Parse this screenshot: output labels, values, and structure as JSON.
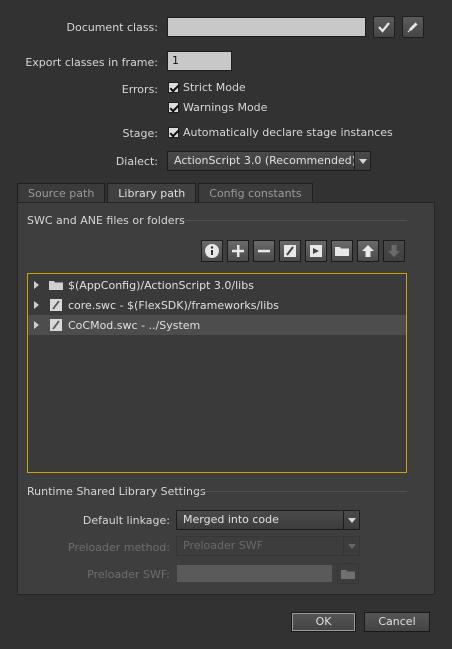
{
  "fields": {
    "document_class_label": "Document class:",
    "document_class_value": "",
    "export_frame_label": "Export classes in frame:",
    "export_frame_value": "1",
    "errors_label": "Errors:",
    "strict_mode_label": "Strict Mode",
    "strict_mode_checked": true,
    "warnings_mode_label": "Warnings Mode",
    "warnings_mode_checked": true,
    "stage_label": "Stage:",
    "auto_declare_label": "Automatically declare stage instances",
    "auto_declare_checked": true,
    "dialect_label": "Dialect:",
    "dialect_value": "ActionScript 3.0 (Recommended)"
  },
  "tabs": [
    {
      "label": "Source path",
      "active": false
    },
    {
      "label": "Library path",
      "active": true
    },
    {
      "label": "Config constants",
      "active": false
    }
  ],
  "library": {
    "section_title": "SWC and ANE files or folders",
    "toolbar_icons": [
      "info-icon",
      "add-icon",
      "remove-icon",
      "flex-sdk-icon",
      "swc-icon",
      "folder-icon",
      "move-up-icon",
      "move-down-icon"
    ],
    "items": [
      {
        "label": "$(AppConfig)/ActionScript 3.0/libs",
        "icon": "folder-icon",
        "selected": false
      },
      {
        "label": "core.swc - $(FlexSDK)/frameworks/libs",
        "icon": "swc-file-icon",
        "selected": false
      },
      {
        "label": "CoCMod.swc - ../System",
        "icon": "swc-file-icon",
        "selected": true
      }
    ]
  },
  "rsl": {
    "section_title": "Runtime Shared Library Settings",
    "default_linkage_label": "Default linkage:",
    "default_linkage_value": "Merged into code",
    "preloader_method_label": "Preloader method:",
    "preloader_method_value": "Preloader SWF",
    "preloader_swf_label": "Preloader SWF:",
    "preloader_swf_value": ""
  },
  "buttons": {
    "ok_label": "OK",
    "cancel_label": "Cancel"
  },
  "colors": {
    "background": "#323232",
    "panel": "#3e3e3e",
    "tree_border": "#c9a400"
  }
}
